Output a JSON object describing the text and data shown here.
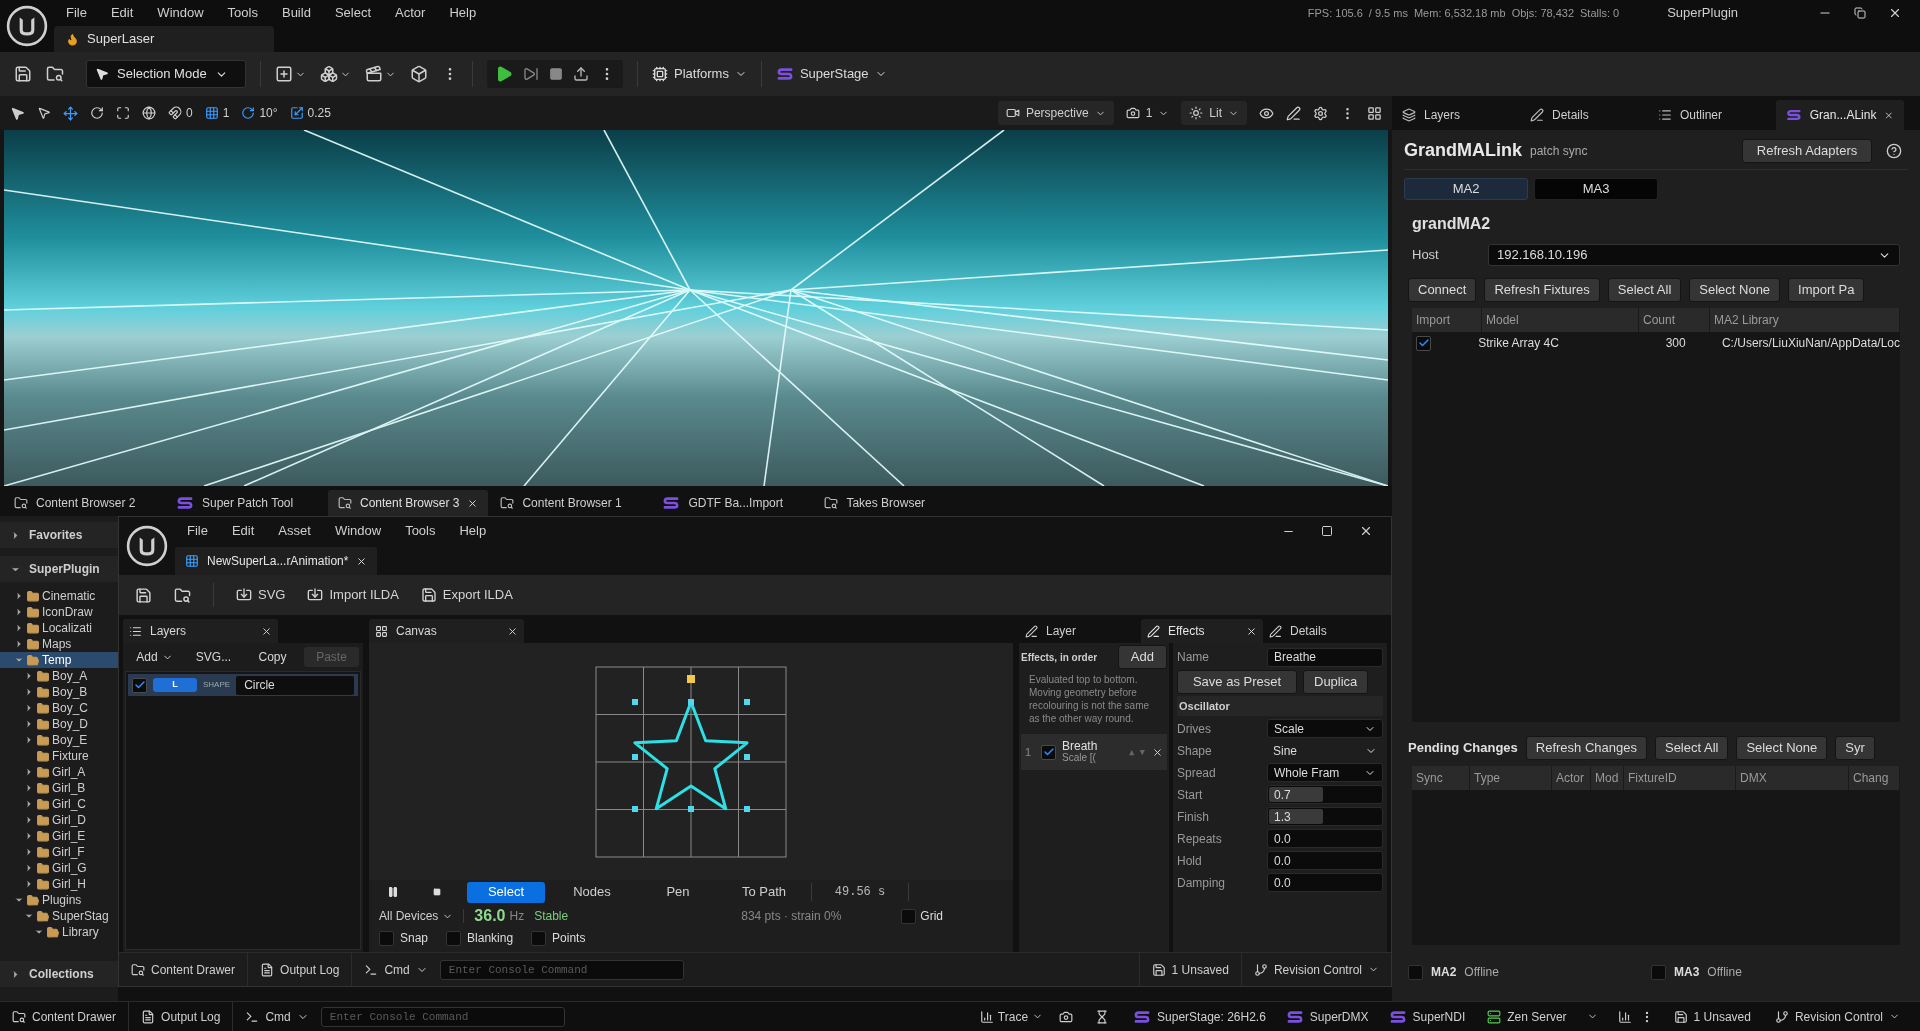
{
  "app_menu": [
    "File",
    "Edit",
    "Window",
    "Tools",
    "Build",
    "Select",
    "Actor",
    "Help"
  ],
  "stats": [
    "FPS: 105.6",
    "/ 9.5 ms",
    "Mem: 6,532.18 mb",
    "Objs: 78,432",
    "Stalls: 0"
  ],
  "project_name": "SuperPlugin",
  "level_tab": {
    "label": "SuperLaser"
  },
  "toolbar": {
    "mode": "Selection Mode",
    "platforms": "Platforms",
    "superstage": "SuperStage"
  },
  "viewport_toolbar": {
    "rotation_snap": "0",
    "grid_snap": "1",
    "angle_snap": "10°",
    "scale_snap": "0.25",
    "view_mode": "Perspective",
    "camera_speed": "1",
    "lighting": "Lit"
  },
  "content_tabs": [
    {
      "label": "Content Browser 2",
      "kind": "browser",
      "selected": false
    },
    {
      "label": "Super Patch Tool",
      "kind": "plugin",
      "selected": false
    },
    {
      "label": "Content Browser 3",
      "kind": "browser",
      "selected": true
    },
    {
      "label": "Content Browser 1",
      "kind": "browser",
      "selected": false
    },
    {
      "label": "GDTF Ba...Import",
      "kind": "plugin",
      "selected": false
    },
    {
      "label": "Takes Browser",
      "kind": "browser",
      "selected": false
    }
  ],
  "content_tree": {
    "favorites": {
      "label": "Favorites",
      "expanded": false
    },
    "root": {
      "label": "SuperPlugin",
      "expanded": true
    },
    "folders": [
      {
        "label": "Cinematic",
        "expanded": false,
        "selected": false
      },
      {
        "label": "IconDraw",
        "expanded": false,
        "selected": false
      },
      {
        "label": "Localizati",
        "expanded": false,
        "selected": false
      },
      {
        "label": "Maps",
        "expanded": false,
        "selected": false
      },
      {
        "label": "Temp",
        "expanded": true,
        "selected": true,
        "children": [
          {
            "label": "Boy_A",
            "expanded": false,
            "selected": false
          },
          {
            "label": "Boy_B",
            "expanded": false,
            "selected": false
          },
          {
            "label": "Boy_C",
            "expanded": false,
            "selected": false
          },
          {
            "label": "Boy_D",
            "expanded": false,
            "selected": false
          },
          {
            "label": "Boy_E",
            "expanded": false,
            "selected": false
          },
          {
            "label": "Fixture",
            "selected": false
          },
          {
            "label": "Girl_A",
            "expanded": false,
            "selected": false
          },
          {
            "label": "Girl_B",
            "expanded": false,
            "selected": false
          },
          {
            "label": "Girl_C",
            "expanded": false,
            "selected": false
          },
          {
            "label": "Girl_D",
            "expanded": false,
            "selected": false
          },
          {
            "label": "Girl_E",
            "expanded": false,
            "selected": false
          },
          {
            "label": "Girl_F",
            "expanded": false,
            "selected": false
          },
          {
            "label": "Girl_G",
            "expanded": false,
            "selected": false
          },
          {
            "label": "Girl_H",
            "expanded": false,
            "selected": false
          }
        ]
      },
      {
        "label": "Plugins",
        "expanded": true,
        "selected": false,
        "children": [
          {
            "label": "SuperStag",
            "expanded": true,
            "selected": false,
            "children": [
              {
                "label": "Library",
                "expanded": true,
                "selected": false
              }
            ]
          }
        ]
      }
    ],
    "collections": {
      "label": "Collections",
      "expanded": false
    }
  },
  "editor_window": {
    "menu": [
      "File",
      "Edit",
      "Asset",
      "Window",
      "Tools",
      "Help"
    ],
    "document_tab": "NewSuperLa...rAnimation*",
    "toolbar": [
      {
        "label": "SVG",
        "kind": "import"
      },
      {
        "label": "Import ILDA",
        "kind": "import"
      },
      {
        "label": "Export ILDA",
        "kind": "export"
      }
    ],
    "layers_panel": {
      "title": "Layers",
      "actions": [
        {
          "label": "Add",
          "kind": "dropdown",
          "disabled": false
        },
        {
          "label": "SVG...",
          "kind": "plain",
          "disabled": false
        },
        {
          "label": "Copy",
          "kind": "plain",
          "disabled": false
        },
        {
          "label": "Paste",
          "kind": "plain",
          "disabled": true
        }
      ],
      "layers": [
        {
          "checked": true,
          "badge": "L",
          "type": "SHAPE",
          "name": "Circle",
          "selected": true
        }
      ]
    },
    "canvas_panel": {
      "title": "Canvas",
      "tools": [
        {
          "label": "Select",
          "selected": true
        },
        {
          "label": "Nodes",
          "selected": false
        },
        {
          "label": "Pen",
          "selected": false
        },
        {
          "label": "To Path",
          "selected": false
        }
      ],
      "time": "49.56 s",
      "devices": "All Devices",
      "rate": "36.0",
      "rate_unit": "Hz",
      "rate_status": "Stable",
      "info": "834 pts · strain 0%",
      "grid": {
        "label": "Grid",
        "checked": false
      },
      "toggles": [
        {
          "label": "Snap",
          "checked": false
        },
        {
          "label": "Blanking",
          "checked": false
        },
        {
          "label": "Points",
          "checked": false
        }
      ]
    },
    "side_tabs": [
      {
        "label": "Layer",
        "selected": false
      },
      {
        "label": "Effects",
        "selected": true
      },
      {
        "label": "Details",
        "selected": false
      }
    ],
    "effects": {
      "heading": "Effects, in order",
      "add": "Add",
      "note": "Evaluated top to bottom. Moving geometry before recolouring is not the same as the other way round.",
      "items": [
        {
          "index": "1",
          "checked": true,
          "name": "Breath",
          "summary": "Scale [("
        }
      ]
    },
    "details": {
      "name_label": "Name",
      "name_value": "Breathe",
      "buttons": [
        "Save as Preset",
        "Duplica"
      ],
      "section": "Oscillator",
      "props": [
        {
          "label": "Drives",
          "kind": "dropdown",
          "value": "Scale"
        },
        {
          "label": "Shape",
          "kind": "select",
          "value": "Sine"
        },
        {
          "label": "Spread",
          "kind": "dropdown",
          "value": "Whole Fram"
        },
        {
          "label": "Start",
          "kind": "slider",
          "value": "0.7",
          "level": 0.47
        },
        {
          "label": "Finish",
          "kind": "slider",
          "value": "1.3",
          "level": 0.47
        },
        {
          "label": "Repeats",
          "kind": "number",
          "value": "0.0"
        },
        {
          "label": "Hold",
          "kind": "number",
          "value": "0.0"
        },
        {
          "label": "Damping",
          "kind": "number",
          "value": "0.0"
        }
      ]
    },
    "status": {
      "content_drawer": "Content Drawer",
      "output_log": "Output Log",
      "cmd": "Cmd",
      "console_placeholder": "Enter Console Command",
      "unsaved": "1 Unsaved",
      "revision": "Revision Control"
    }
  },
  "right_tabs": [
    {
      "label": "Layers",
      "kind": "layers",
      "selected": false
    },
    {
      "label": "Details",
      "kind": "details",
      "selected": false
    },
    {
      "label": "Outliner",
      "kind": "outliner",
      "selected": false
    },
    {
      "label": "Gran...ALink",
      "kind": "plugin",
      "selected": true
    }
  ],
  "grandmalink": {
    "title": "GrandMALink",
    "subtitle": "patch sync",
    "refresh": "Refresh Adapters",
    "consoles": [
      {
        "label": "MA2",
        "selected": true
      },
      {
        "label": "MA3",
        "selected": false
      }
    ],
    "heading": "grandMA2",
    "host_label": "Host",
    "host_value": "192.168.10.196",
    "actions": [
      "Connect",
      "Refresh Fixtures",
      "Select All",
      "Select None",
      "Import Pa"
    ],
    "fixture_columns": [
      "Import",
      "Model",
      "Count",
      "MA2 Library"
    ],
    "fixtures": [
      {
        "import": true,
        "model": "Strike Array 4C",
        "count": "300",
        "library": "C:/Users/LiuXiuNan/AppData/Loc"
      }
    ],
    "pending_title": "Pending Changes",
    "pending_actions": [
      "Refresh Changes",
      "Select All",
      "Select None",
      "Syr"
    ],
    "pending_columns": [
      "Sync",
      "Type",
      "Actor",
      "Mod",
      "FixtureID",
      "DMX",
      "Chang"
    ],
    "connections": [
      {
        "label": "MA2",
        "checked": false,
        "status": "Offline"
      },
      {
        "label": "MA3",
        "checked": false,
        "status": "Offline"
      }
    ]
  },
  "status_bar": {
    "content_drawer": "Content Drawer",
    "output_log": "Output Log",
    "cmd": "Cmd",
    "console_placeholder": "Enter Console Command",
    "trace": "Trace",
    "plugins": [
      "SuperStage: 26H2.6",
      "SuperDMX",
      "SuperNDI"
    ],
    "zen": "Zen Server",
    "unsaved": "1 Unsaved",
    "revision": "Revision Control"
  }
}
